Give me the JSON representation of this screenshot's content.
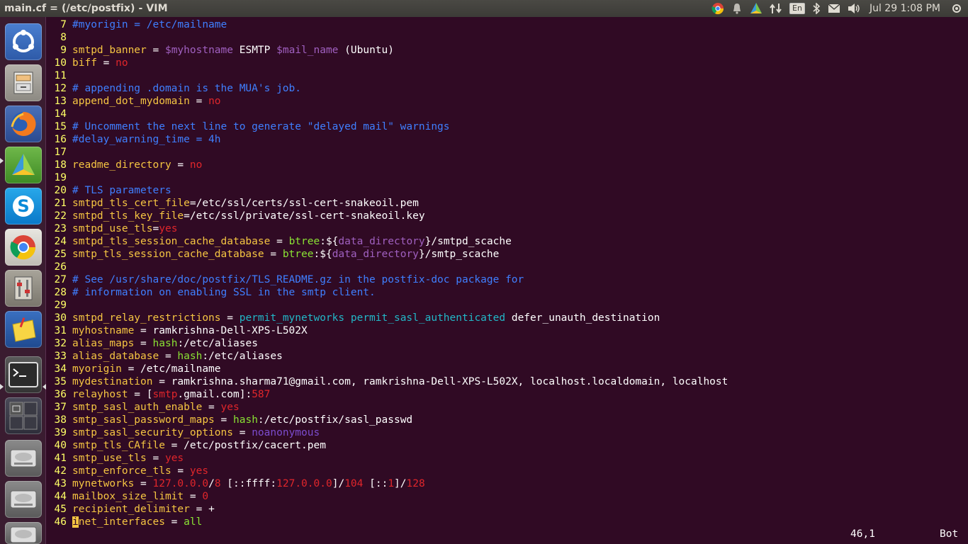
{
  "topbar": {
    "title": "main.cf = (/etc/postfix) - VIM",
    "keyboard_layout": "En",
    "clock": "Jul 29  1:08 PM",
    "icons": [
      "chrome-icon",
      "notifications-icon",
      "update-icon",
      "network-arrows-icon",
      "keyboard-icon",
      "bluetooth-icon",
      "mail-icon",
      "volume-icon"
    ]
  },
  "launcher": {
    "items": [
      {
        "name": "ubuntu-dash",
        "icon": "ubuntu-icon"
      },
      {
        "name": "files",
        "icon": "file-cabinet-icon"
      },
      {
        "name": "firefox",
        "icon": "firefox-icon"
      },
      {
        "name": "software-updater",
        "icon": "software-icon"
      },
      {
        "name": "skype",
        "icon": "skype-icon"
      },
      {
        "name": "chrome",
        "icon": "chrome-icon"
      },
      {
        "name": "system-settings",
        "icon": "settings-icon"
      },
      {
        "name": "notes",
        "icon": "notes-icon"
      },
      {
        "name": "terminal",
        "icon": "terminal-icon"
      },
      {
        "name": "workspace-switcher",
        "icon": "workspace-icon"
      },
      {
        "name": "drive-1",
        "icon": "hard-drive-icon"
      },
      {
        "name": "drive-2",
        "icon": "hard-drive-icon"
      },
      {
        "name": "drive-3",
        "icon": "hard-drive-icon"
      }
    ]
  },
  "editor": {
    "lines": [
      {
        "n": "7",
        "segs": [
          [
            "#myorigin = /etc/mailname",
            "com"
          ]
        ]
      },
      {
        "n": "8",
        "segs": []
      },
      {
        "n": "9",
        "segs": [
          [
            "smtpd_banner",
            "key"
          ],
          [
            " = ",
            "wht"
          ],
          [
            "$myhostname",
            "pur"
          ],
          [
            " ESMTP ",
            "wht"
          ],
          [
            "$mail_name",
            "pur"
          ],
          [
            " (Ubuntu)",
            "wht"
          ]
        ]
      },
      {
        "n": "10",
        "segs": [
          [
            "biff",
            "key"
          ],
          [
            " = ",
            "wht"
          ],
          [
            "no",
            "red"
          ]
        ]
      },
      {
        "n": "11",
        "segs": []
      },
      {
        "n": "12",
        "segs": [
          [
            "# appending .domain is the MUA's job.",
            "com"
          ]
        ]
      },
      {
        "n": "13",
        "segs": [
          [
            "append_dot_mydomain",
            "key"
          ],
          [
            " = ",
            "wht"
          ],
          [
            "no",
            "red"
          ]
        ]
      },
      {
        "n": "14",
        "segs": []
      },
      {
        "n": "15",
        "segs": [
          [
            "# Uncomment the next line to generate \"delayed mail\" warnings",
            "com"
          ]
        ]
      },
      {
        "n": "16",
        "segs": [
          [
            "#delay_warning_time = 4h",
            "com"
          ]
        ]
      },
      {
        "n": "17",
        "segs": []
      },
      {
        "n": "18",
        "segs": [
          [
            "readme_directory",
            "key"
          ],
          [
            " = ",
            "wht"
          ],
          [
            "no",
            "red"
          ]
        ]
      },
      {
        "n": "19",
        "segs": []
      },
      {
        "n": "20",
        "segs": [
          [
            "# TLS parameters",
            "com"
          ]
        ]
      },
      {
        "n": "21",
        "segs": [
          [
            "smtpd_tls_cert_file",
            "key"
          ],
          [
            "=/etc/ssl/certs/ssl-cert-snakeoil.pem",
            "wht"
          ]
        ]
      },
      {
        "n": "22",
        "segs": [
          [
            "smtpd_tls_key_file",
            "key"
          ],
          [
            "=/etc/ssl/private/ssl-cert-snakeoil.key",
            "wht"
          ]
        ]
      },
      {
        "n": "23",
        "segs": [
          [
            "smtpd_use_tls",
            "key"
          ],
          [
            "=",
            "wht"
          ],
          [
            "yes",
            "red"
          ]
        ]
      },
      {
        "n": "24",
        "segs": [
          [
            "smtpd_tls_session_cache_database",
            "key"
          ],
          [
            " = ",
            "wht"
          ],
          [
            "btree",
            "grn"
          ],
          [
            ":${",
            "wht"
          ],
          [
            "data_directory",
            "pur"
          ],
          [
            "}/smtpd_scache",
            "wht"
          ]
        ]
      },
      {
        "n": "25",
        "segs": [
          [
            "smtp_tls_session_cache_database",
            "key"
          ],
          [
            " = ",
            "wht"
          ],
          [
            "btree",
            "grn"
          ],
          [
            ":${",
            "wht"
          ],
          [
            "data_directory",
            "pur"
          ],
          [
            "}/smtp_scache",
            "wht"
          ]
        ]
      },
      {
        "n": "26",
        "segs": []
      },
      {
        "n": "27",
        "segs": [
          [
            "# See /usr/share/doc/postfix/TLS_README.gz in the postfix-doc package for",
            "com"
          ]
        ]
      },
      {
        "n": "28",
        "segs": [
          [
            "# information on enabling SSL in the smtp client.",
            "com"
          ]
        ]
      },
      {
        "n": "29",
        "segs": []
      },
      {
        "n": "30",
        "segs": [
          [
            "smtpd_relay_restrictions",
            "key"
          ],
          [
            " = ",
            "wht"
          ],
          [
            "permit_mynetworks permit_sasl_authenticated",
            "cyn"
          ],
          [
            " defer_unauth_destination",
            "wht"
          ]
        ]
      },
      {
        "n": "31",
        "segs": [
          [
            "myhostname",
            "key"
          ],
          [
            " = ramkrishna-Dell-XPS-L502X",
            "wht"
          ]
        ]
      },
      {
        "n": "32",
        "segs": [
          [
            "alias_maps",
            "key"
          ],
          [
            " = ",
            "wht"
          ],
          [
            "hash",
            "grn"
          ],
          [
            ":/etc/aliases",
            "wht"
          ]
        ]
      },
      {
        "n": "33",
        "segs": [
          [
            "alias_database",
            "key"
          ],
          [
            " = ",
            "wht"
          ],
          [
            "hash",
            "grn"
          ],
          [
            ":/etc/aliases",
            "wht"
          ]
        ]
      },
      {
        "n": "34",
        "segs": [
          [
            "myorigin",
            "key"
          ],
          [
            " = /etc/mailname",
            "wht"
          ]
        ]
      },
      {
        "n": "35",
        "segs": [
          [
            "mydestination",
            "key"
          ],
          [
            " = ramkrishna.sharma71@gmail.com, ramkrishna-Dell-XPS-L502X, localhost.localdomain, localhost",
            "wht"
          ]
        ]
      },
      {
        "n": "36",
        "segs": [
          [
            "relayhost",
            "key"
          ],
          [
            " = [",
            "wht"
          ],
          [
            "smtp",
            "red"
          ],
          [
            ".gmail.com]:",
            "wht"
          ],
          [
            "587",
            "red"
          ]
        ]
      },
      {
        "n": "37",
        "segs": [
          [
            "smtp_sasl_auth_enable",
            "key"
          ],
          [
            " = ",
            "wht"
          ],
          [
            "yes",
            "red"
          ]
        ]
      },
      {
        "n": "38",
        "segs": [
          [
            "smtp_sasl_password_maps",
            "key"
          ],
          [
            " = ",
            "wht"
          ],
          [
            "hash",
            "grn"
          ],
          [
            ":/etc/postfix/sasl_passwd",
            "wht"
          ]
        ]
      },
      {
        "n": "39",
        "segs": [
          [
            "smtp_sasl_security_options",
            "key"
          ],
          [
            " = ",
            "wht"
          ],
          [
            "noanonymous",
            "vio"
          ]
        ]
      },
      {
        "n": "40",
        "segs": [
          [
            "smtp_tls_CAfile",
            "key"
          ],
          [
            " = /etc/postfix/cacert.pem",
            "wht"
          ]
        ]
      },
      {
        "n": "41",
        "segs": [
          [
            "smtp_use_tls",
            "key"
          ],
          [
            " = ",
            "wht"
          ],
          [
            "yes",
            "red"
          ]
        ]
      },
      {
        "n": "42",
        "segs": [
          [
            "smtp_enforce_tls",
            "key"
          ],
          [
            " = ",
            "wht"
          ],
          [
            "yes",
            "red"
          ]
        ]
      },
      {
        "n": "43",
        "segs": [
          [
            "mynetworks",
            "key"
          ],
          [
            " = ",
            "wht"
          ],
          [
            "127.0.0.0",
            "red"
          ],
          [
            "/",
            "wht"
          ],
          [
            "8",
            "red"
          ],
          [
            " [::ffff:",
            "wht"
          ],
          [
            "127.0.0.0",
            "red"
          ],
          [
            "]/",
            "wht"
          ],
          [
            "104",
            "red"
          ],
          [
            " [::",
            "wht"
          ],
          [
            "1",
            "red"
          ],
          [
            "]/",
            "wht"
          ],
          [
            "128",
            "red"
          ]
        ]
      },
      {
        "n": "44",
        "segs": [
          [
            "mailbox_size_limit",
            "key"
          ],
          [
            " = ",
            "wht"
          ],
          [
            "0",
            "red"
          ]
        ]
      },
      {
        "n": "45",
        "segs": [
          [
            "recipient_delimiter",
            "key"
          ],
          [
            " = +",
            "wht"
          ]
        ]
      },
      {
        "n": "46",
        "segs": [
          [
            "i",
            "cursor"
          ],
          [
            "net_interfaces",
            "key"
          ],
          [
            " = ",
            "wht"
          ],
          [
            "all",
            "grn"
          ]
        ]
      }
    ],
    "status_position": "46,1",
    "status_scroll": "Bot"
  },
  "colors": {
    "terminal_bg": "#300a24",
    "key": "#f5c542",
    "comment": "#3f7fff",
    "value_red": "#e0262b",
    "value_cyan": "#22b8c8",
    "value_green": "#8ae234",
    "variable_purple": "#a060c0"
  }
}
